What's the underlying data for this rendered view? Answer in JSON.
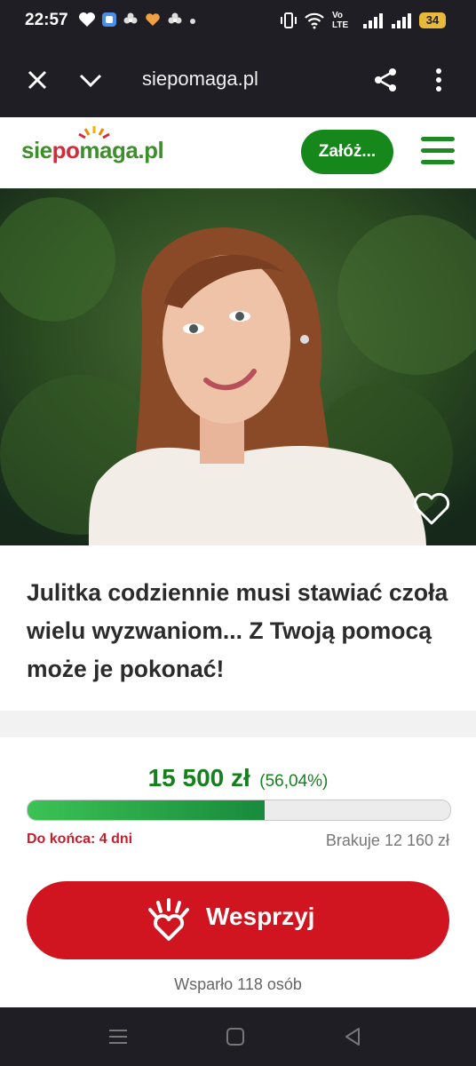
{
  "status_bar": {
    "time": "22:57",
    "network_label": "Vo LTE",
    "battery": "34",
    "icons": [
      "heart-icon",
      "app-icon",
      "flower-icon",
      "heart-hands-icon",
      "flower-icon",
      "dot-icon",
      "vibrate-icon",
      "wifi-icon",
      "signal-icon",
      "signal-icon",
      "battery-icon"
    ]
  },
  "browser": {
    "url": "siepomaga.pl",
    "icons": [
      "close-icon",
      "chevron-down-icon",
      "share-icon",
      "more-vert-icon"
    ]
  },
  "site_header": {
    "logo_part1": "sie",
    "logo_part2": "po",
    "logo_part3": "maga.pl",
    "create_label": "Załóż...",
    "menu_icon": "hamburger-icon"
  },
  "hero": {
    "favorite_icon": "heart-outline-icon"
  },
  "campaign": {
    "title": "Julitka codziennie musi stawiać czoła wielu wyzwaniom... Z Twoją pomocą może je pokonać!"
  },
  "progress": {
    "amount": "15 500 zł",
    "percent_label": "(56,04%)",
    "percent_value": 56.04,
    "deadline": "Do końca: 4 dni",
    "missing": "Brakuje 12 160 zł"
  },
  "support": {
    "button_label": "Wesprzyj",
    "button_icon": "hand-heart-icon",
    "supporters": "Wsparło 118 osób"
  },
  "colors": {
    "brand_green": "#16881b",
    "brand_red": "#d01521",
    "dark_bar": "#1e1e24"
  },
  "nav_bar": {
    "icons": [
      "recent-apps-icon",
      "home-icon",
      "back-icon"
    ]
  }
}
